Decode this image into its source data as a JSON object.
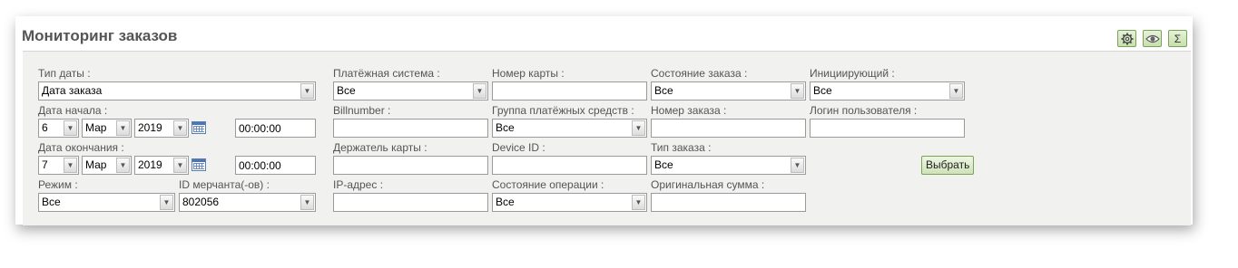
{
  "title": "Мониторинг заказов",
  "toolbar": {
    "settings_icon": "gear-icon",
    "view_icon": "eye-icon",
    "sum_label": "Σ"
  },
  "filters": {
    "date_type": {
      "label": "Тип даты :",
      "value": "Дата заказа"
    },
    "start_date": {
      "label": "Дата начала :",
      "day": "6",
      "month": "Мар",
      "year": "2019",
      "time": "00:00:00"
    },
    "end_date": {
      "label": "Дата окончания :",
      "day": "7",
      "month": "Мар",
      "year": "2019",
      "time": "00:00:00"
    },
    "mode": {
      "label": "Режим :",
      "value": "Все"
    },
    "merchant_id": {
      "label": "ID мерчанта(-ов) :",
      "value": "802056"
    },
    "payment_system": {
      "label": "Платёжная система :",
      "value": "Все"
    },
    "billnumber": {
      "label": "Billnumber :",
      "value": ""
    },
    "card_holder": {
      "label": "Держатель карты :",
      "value": ""
    },
    "ip_address": {
      "label": "IP-адрес :",
      "value": ""
    },
    "card_number": {
      "label": "Номер карты :",
      "value": ""
    },
    "payment_group": {
      "label": "Группа платёжных средств :",
      "value": "Все"
    },
    "device_id": {
      "label": "Device ID :",
      "value": ""
    },
    "operation_state": {
      "label": "Состояние операции :",
      "value": "Все"
    },
    "order_state": {
      "label": "Состояние заказа :",
      "value": "Все"
    },
    "order_number": {
      "label": "Номер заказа :",
      "value": ""
    },
    "order_type": {
      "label": "Тип заказа :",
      "value": "Все"
    },
    "original_amount": {
      "label": "Оригинальная сумма :",
      "value": ""
    },
    "initiator": {
      "label": "Инициирующий :",
      "value": "Все"
    },
    "user_login": {
      "label": "Логин пользователя :",
      "value": ""
    }
  },
  "select_button": "Выбрать"
}
